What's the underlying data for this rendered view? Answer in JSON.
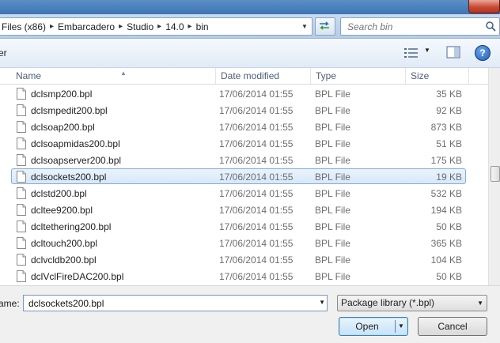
{
  "address": {
    "crumbs": [
      "Files (x86)",
      "Embarcadero",
      "Studio",
      "14.0",
      "bin"
    ]
  },
  "search": {
    "placeholder": "Search bin"
  },
  "toolbar": {
    "left_text": "er"
  },
  "columns": {
    "name": "Name",
    "date": "Date modified",
    "type": "Type",
    "size": "Size"
  },
  "files": [
    {
      "name": "dclsmp200.bpl",
      "date": "17/06/2014 01:55",
      "type": "BPL File",
      "size": "35 KB"
    },
    {
      "name": "dclsmpedit200.bpl",
      "date": "17/06/2014 01:55",
      "type": "BPL File",
      "size": "92 KB"
    },
    {
      "name": "dclsoap200.bpl",
      "date": "17/06/2014 01:55",
      "type": "BPL File",
      "size": "873 KB"
    },
    {
      "name": "dclsoapmidas200.bpl",
      "date": "17/06/2014 01:55",
      "type": "BPL File",
      "size": "51 KB"
    },
    {
      "name": "dclsoapserver200.bpl",
      "date": "17/06/2014 01:55",
      "type": "BPL File",
      "size": "175 KB"
    },
    {
      "name": "dclsockets200.bpl",
      "date": "17/06/2014 01:55",
      "type": "BPL File",
      "size": "19 KB",
      "selected": true
    },
    {
      "name": "dclstd200.bpl",
      "date": "17/06/2014 01:55",
      "type": "BPL File",
      "size": "532 KB"
    },
    {
      "name": "dcltee9200.bpl",
      "date": "17/06/2014 01:55",
      "type": "BPL File",
      "size": "194 KB"
    },
    {
      "name": "dcltethering200.bpl",
      "date": "17/06/2014 01:55",
      "type": "BPL File",
      "size": "50 KB"
    },
    {
      "name": "dcltouch200.bpl",
      "date": "17/06/2014 01:55",
      "type": "BPL File",
      "size": "365 KB"
    },
    {
      "name": "dclvcldb200.bpl",
      "date": "17/06/2014 01:55",
      "type": "BPL File",
      "size": "104 KB"
    },
    {
      "name": "dclVclFireDAC200.bpl",
      "date": "17/06/2014 01:55",
      "type": "BPL File",
      "size": "50 KB"
    }
  ],
  "footer": {
    "filename_label": "ame:",
    "filename_value": "dclsockets200.bpl",
    "filter_value": "Package library  (*.bpl)",
    "open_label": "Open",
    "cancel_label": "Cancel"
  }
}
